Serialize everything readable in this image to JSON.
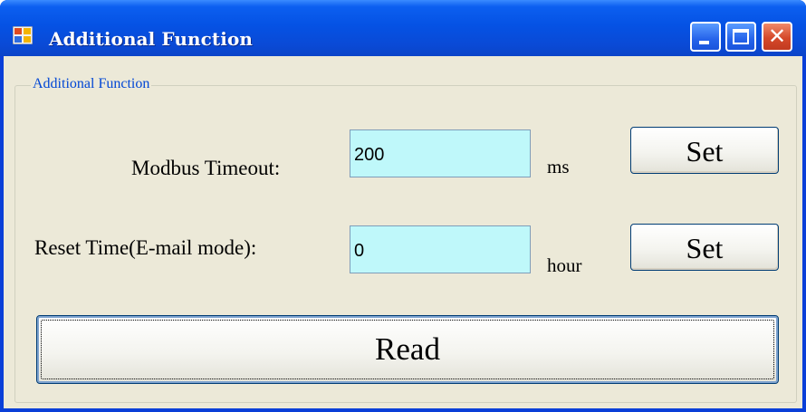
{
  "window": {
    "title": "Additional Function",
    "icon": "app-window-icon",
    "controls": {
      "minimize": "minimize-icon",
      "maximize": "maximize-icon",
      "close": "close-icon",
      "close_glyph": "✕"
    }
  },
  "group": {
    "legend": "Additional Function"
  },
  "modbus": {
    "label": "Modbus Timeout:",
    "value": "200",
    "unit": "ms",
    "button": "Set"
  },
  "reset": {
    "label": "Reset Time(E-mail mode):",
    "value": "0",
    "unit": "hour",
    "button": "Set"
  },
  "read_button": "Read",
  "colors": {
    "title_bar": "#0552e4",
    "client_bg": "#ece9d8",
    "field_bg": "#bff8fa",
    "legend_text": "#0046d5",
    "close_button": "#d5492a"
  }
}
